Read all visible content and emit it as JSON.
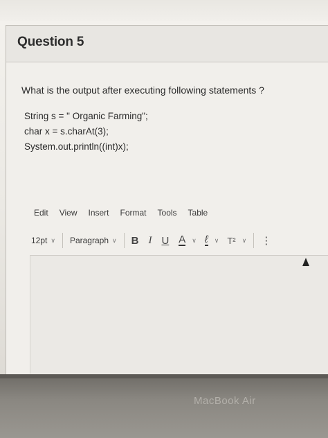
{
  "question": {
    "title": "Question 5",
    "prompt": "What is the output after executing following statements ?",
    "code": [
      "String s = \" Organic Farming\";",
      "char x = s.charAt(3);",
      "System.out.println((int)x);"
    ]
  },
  "editor": {
    "menu": [
      "Edit",
      "View",
      "Insert",
      "Format",
      "Tools",
      "Table"
    ],
    "font_size": "12pt",
    "block_format": "Paragraph",
    "buttons": {
      "bold": "B",
      "italic": "I",
      "underline": "U",
      "text_color": "A",
      "highlight": "ℓ",
      "superscript": "T²",
      "more": "⋮"
    }
  },
  "device": {
    "brand": "MacBook Air"
  },
  "colors": {
    "background": "#f1efeb",
    "header": "#e8e6e2",
    "text": "#2a2a2a"
  }
}
